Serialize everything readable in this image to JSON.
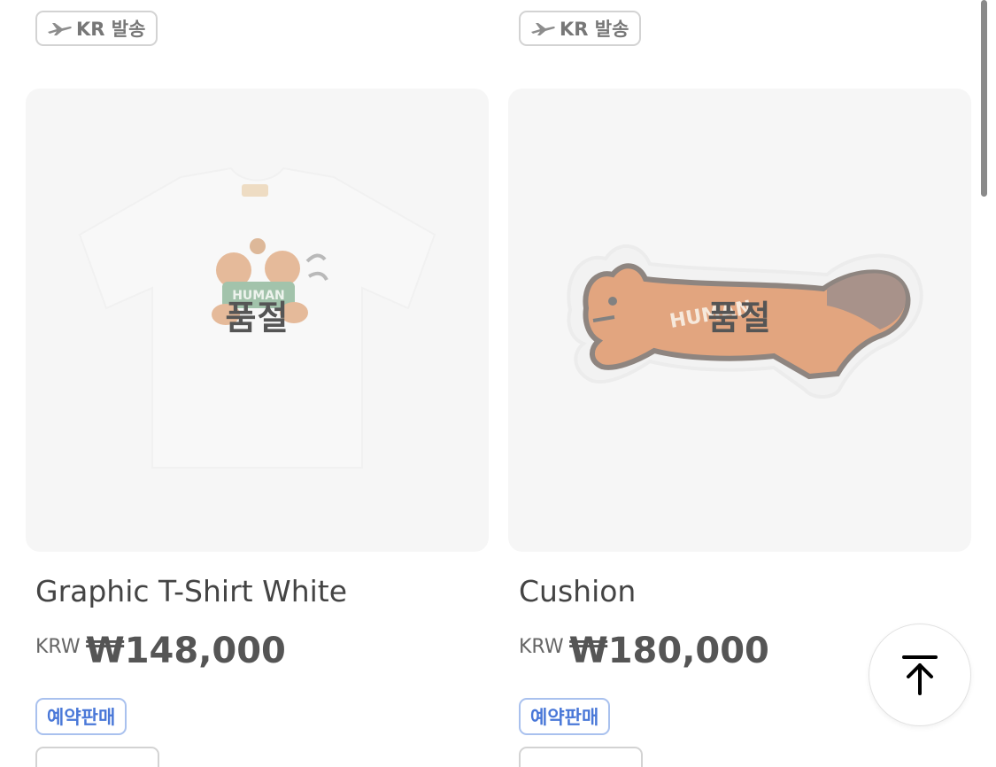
{
  "shipping_badge": {
    "icon": "airplane-icon",
    "label": "KR 발송"
  },
  "products": [
    {
      "name": "Graphic T-Shirt White",
      "currency": "KRW",
      "price": "₩148,000",
      "status_overlay": "품절",
      "tag": "예약판매",
      "image_icon": "tshirt-image"
    },
    {
      "name": "Cushion",
      "currency": "KRW",
      "price": "₩180,000",
      "status_overlay": "품절",
      "tag": "예약판매",
      "image_icon": "squirrel-cushion-image"
    }
  ],
  "scroll_top_button": {
    "icon": "arrow-up-to-top-icon"
  },
  "colors": {
    "card_background": "#f6f6f6",
    "preorder_tag": "#4a78d8",
    "badge_border": "#d3d3d3"
  }
}
